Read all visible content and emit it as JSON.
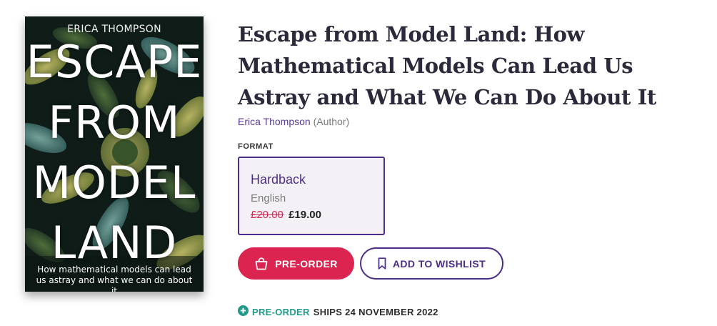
{
  "cover": {
    "author": "ERICA THOMPSON",
    "title_lines": [
      "ESCAPE",
      "FROM",
      "MODEL",
      "LAND"
    ],
    "subtitle_line1": "How mathematical models can lead",
    "subtitle_line2": "us astray and what we can do about it"
  },
  "product": {
    "title": "Escape from Model Land: How Mathematical Models Can Lead Us Astray and What We Can Do About It",
    "author_name": "Erica Thompson",
    "author_role": "(Author)"
  },
  "format": {
    "label": "FORMAT",
    "selected": {
      "name": "Hardback",
      "language": "English",
      "price_original": "£20.00",
      "price_current": "£19.00"
    }
  },
  "actions": {
    "preorder_label": "PRE-ORDER",
    "wishlist_label": "ADD TO WISHLIST"
  },
  "shipping": {
    "tag": "PRE-ORDER",
    "text": "SHIPS 24 NOVEMBER 2022"
  },
  "colors": {
    "brand_purple": "#4c2e8a",
    "preorder_red": "#dc2450",
    "status_teal": "#1f9a8a"
  },
  "icons": {
    "preorder_button": "shopping-bag-icon",
    "wishlist_button": "bookmark-icon",
    "shipping_status": "plus-circle-icon"
  }
}
